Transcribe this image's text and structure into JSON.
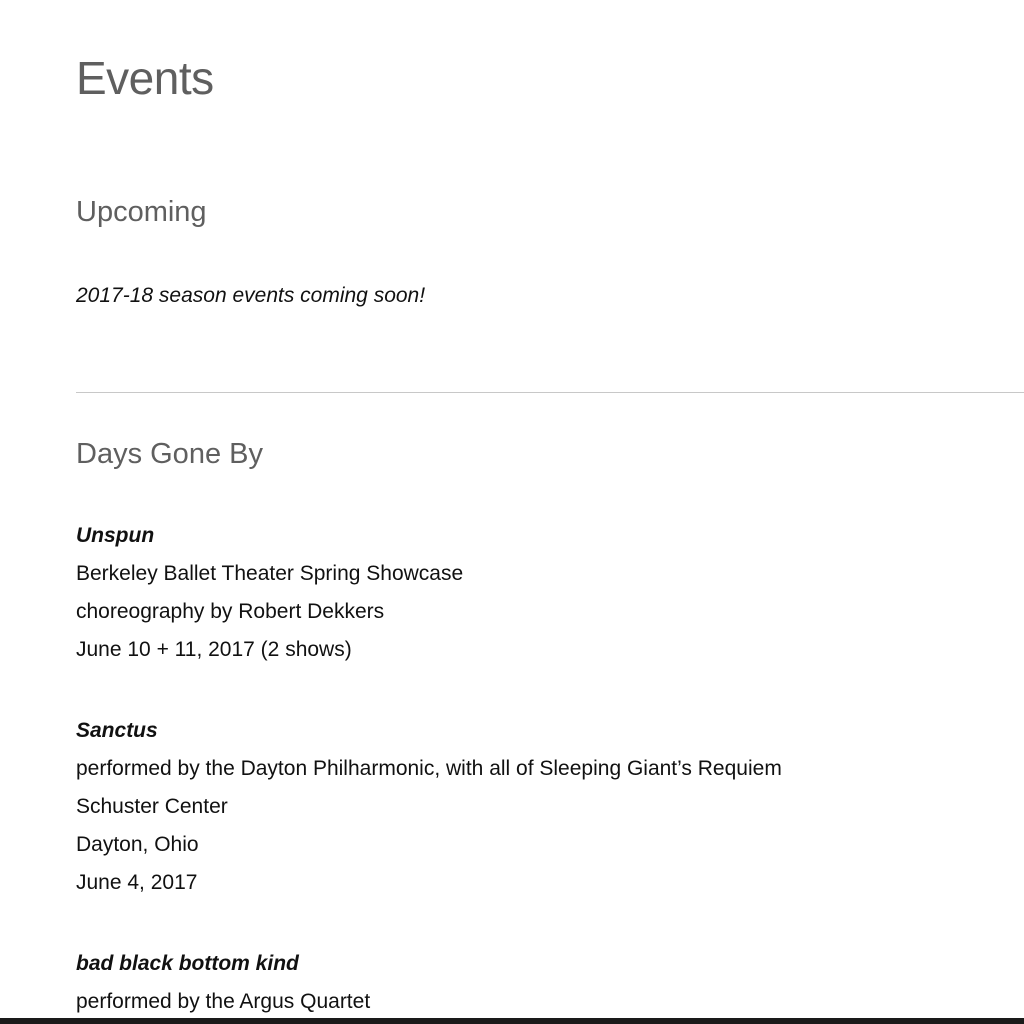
{
  "page": {
    "title": "Events"
  },
  "upcoming": {
    "heading": "Upcoming",
    "note": "2017-18 season events coming soon!"
  },
  "past": {
    "heading": "Days Gone By",
    "events": [
      {
        "title": "Unspun",
        "lines": [
          "Berkeley Ballet Theater Spring Showcase",
          "choreography by Robert Dekkers",
          "June 10 + 11, 2017 (2 shows)"
        ]
      },
      {
        "title": "Sanctus",
        "lines": [
          "performed by the Dayton Philharmonic, with all of Sleeping Giant’s Requiem",
          "Schuster Center",
          "Dayton, Ohio",
          "June 4, 2017"
        ]
      },
      {
        "title": "bad black bottom kind",
        "lines": [
          "performed by the Argus Quartet"
        ]
      }
    ]
  },
  "colors": {
    "heading": "#5f5f5f",
    "body_text": "#111111",
    "divider": "#c8c8c8",
    "background": "#ffffff"
  }
}
